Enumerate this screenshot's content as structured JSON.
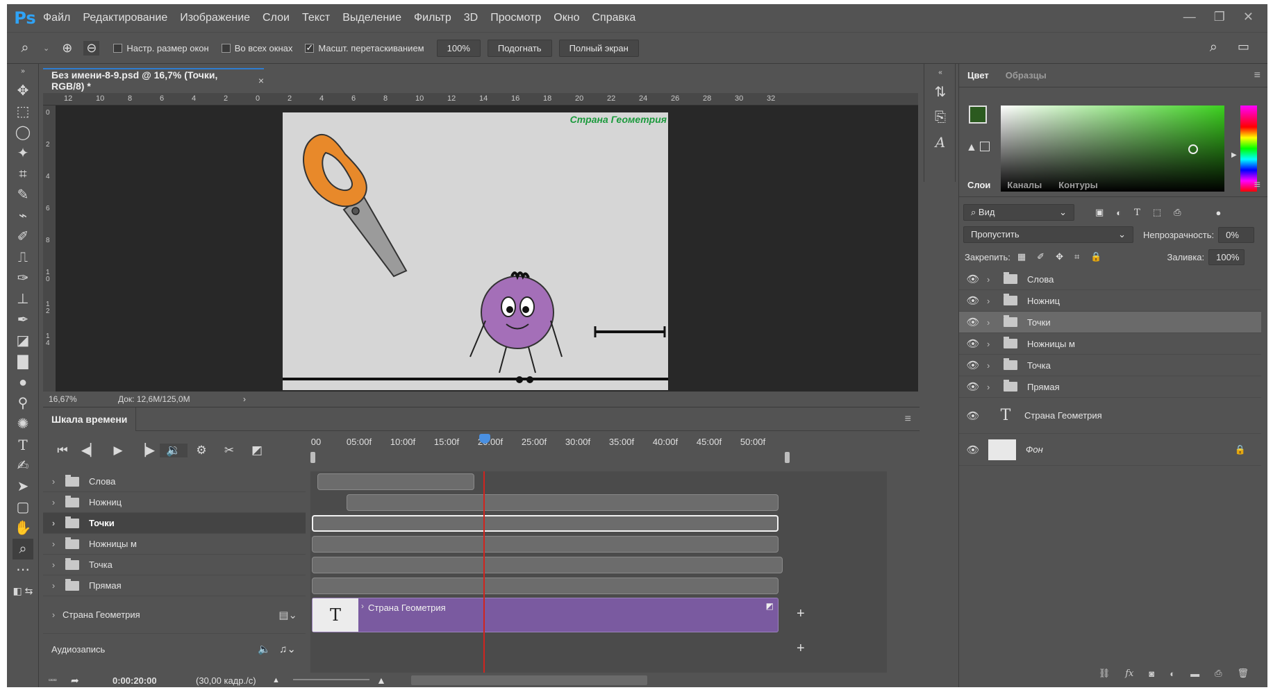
{
  "app": {
    "logo": "Ps",
    "menu": [
      "Файл",
      "Редактирование",
      "Изображение",
      "Слои",
      "Текст",
      "Выделение",
      "Фильтр",
      "3D",
      "Просмотр",
      "Окно",
      "Справка"
    ]
  },
  "options": {
    "resize_windows": "Настр. размер окон",
    "all_windows": "Во всех окнах",
    "scrubby_zoom": "Масшт. перетаскиванием",
    "zoom_value": "100%",
    "fit": "Подогнать",
    "full_screen": "Полный экран"
  },
  "document": {
    "tab_title": "Без имени-8-9.psd @ 16,7% (Точки, RGB/8) *",
    "artboard_title": "Страна Геометрия",
    "ruler_top": [
      "12",
      "10",
      "8",
      "6",
      "4",
      "2",
      "0",
      "2",
      "4",
      "6",
      "8",
      "10",
      "12",
      "14",
      "16",
      "18",
      "20",
      "22",
      "24",
      "26",
      "28",
      "30",
      "32"
    ],
    "ruler_left": [
      "0",
      "2",
      "4",
      "6",
      "8",
      "1 0",
      "1 2",
      "1 4"
    ],
    "zoom": "16,67%",
    "doc_size": "Док: 12,6M/125,0M"
  },
  "timeline": {
    "title": "Шкала времени",
    "ticks": [
      "00",
      "05:00f",
      "10:00f",
      "15:00f",
      "20:00f",
      "25:00f",
      "30:00f",
      "35:00f",
      "40:00f",
      "45:00f",
      "50:00f"
    ],
    "layers": [
      "Слова",
      "Ножниц",
      "Точки",
      "Ножницы м",
      "Точка",
      "Прямая"
    ],
    "selected_layer": "Точки",
    "text_layer": "Страна Геометрия",
    "audio_label": "Аудиозапись",
    "timecode": "0:00:20:00",
    "fps": "(30,00 кадр./с)",
    "playhead_frame": "20:00f"
  },
  "panels": {
    "color_tabs": [
      "Цвет",
      "Образцы"
    ],
    "fg_color": "#2b5a1f",
    "bg_color": "#1f3fd6",
    "layer_tabs": [
      "Слои",
      "Каналы",
      "Контуры"
    ],
    "filter_kind": "Вид",
    "blend_mode": "Пропустить",
    "opacity_label": "Непрозрачность:",
    "opacity_value": "0%",
    "lock_label": "Закрепить:",
    "fill_label": "Заливка:",
    "fill_value": "100%",
    "layers": [
      "Слова",
      "Ножниц",
      "Точки",
      "Ножницы м",
      "Точка",
      "Прямая"
    ],
    "text_layer": "Страна Геометрия",
    "background_layer": "Фон"
  }
}
